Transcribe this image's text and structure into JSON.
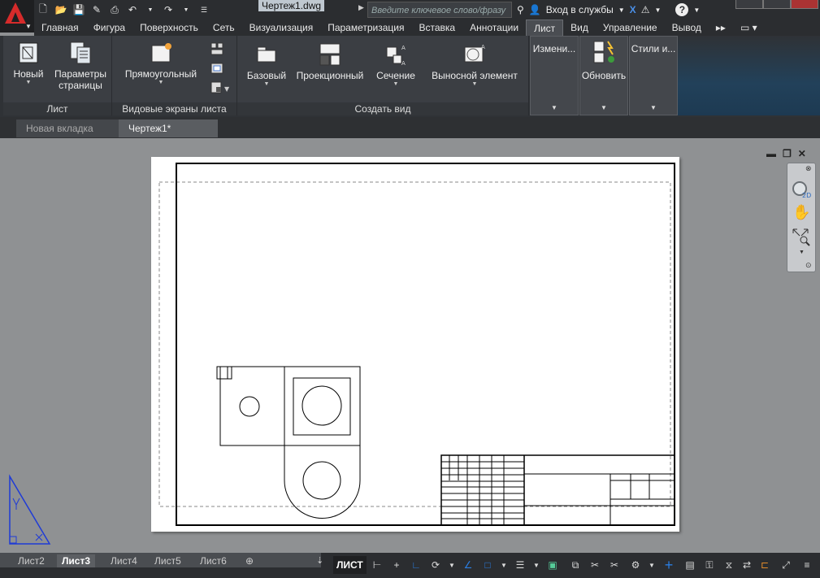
{
  "window": {
    "filename": "Чертеж1.dwg",
    "search_placeholder": "Введите ключевое слово/фразу",
    "signin": "Вход в службы"
  },
  "menu": {
    "tabs": [
      "Главная",
      "Фигура",
      "Поверхность",
      "Сеть",
      "Визуализация",
      "Параметризация",
      "Вставка",
      "Аннотации",
      "Лист",
      "Вид",
      "Управление",
      "Вывод"
    ],
    "active": "Лист"
  },
  "ribbon": {
    "list_panel": {
      "title": "Лист",
      "new_label": "Новый",
      "page_setup_label_1": "Параметры",
      "page_setup_label_2": "страницы"
    },
    "viewports_panel": {
      "title": "Видовые экраны листа",
      "rect_label": "Прямоугольный"
    },
    "create_view_panel": {
      "title": "Создать вид",
      "base_label": "Базовый",
      "projected_label": "Проекционный",
      "section_label": "Сечение",
      "detail_label": "Выносной элемент"
    },
    "modify_panel": {
      "label": "Измени..."
    },
    "update_panel": {
      "label": "Обновить"
    },
    "styles_panel": {
      "label": "Стили и..."
    }
  },
  "file_tabs": {
    "tabs": [
      "Новая вкладка",
      "Чертеж1*"
    ],
    "active": "Чертеж1*"
  },
  "layout_tabs": {
    "tabs": [
      "Лист2",
      "Лист3",
      "Лист4",
      "Лист5",
      "Лист6"
    ],
    "active": "Лист3"
  },
  "status": {
    "space_label": "ЛИСТ"
  },
  "colors": {
    "accent_red": "#d62b2b",
    "ucs_blue": "#1f3bd6",
    "status_blue": "#2a7de1"
  }
}
